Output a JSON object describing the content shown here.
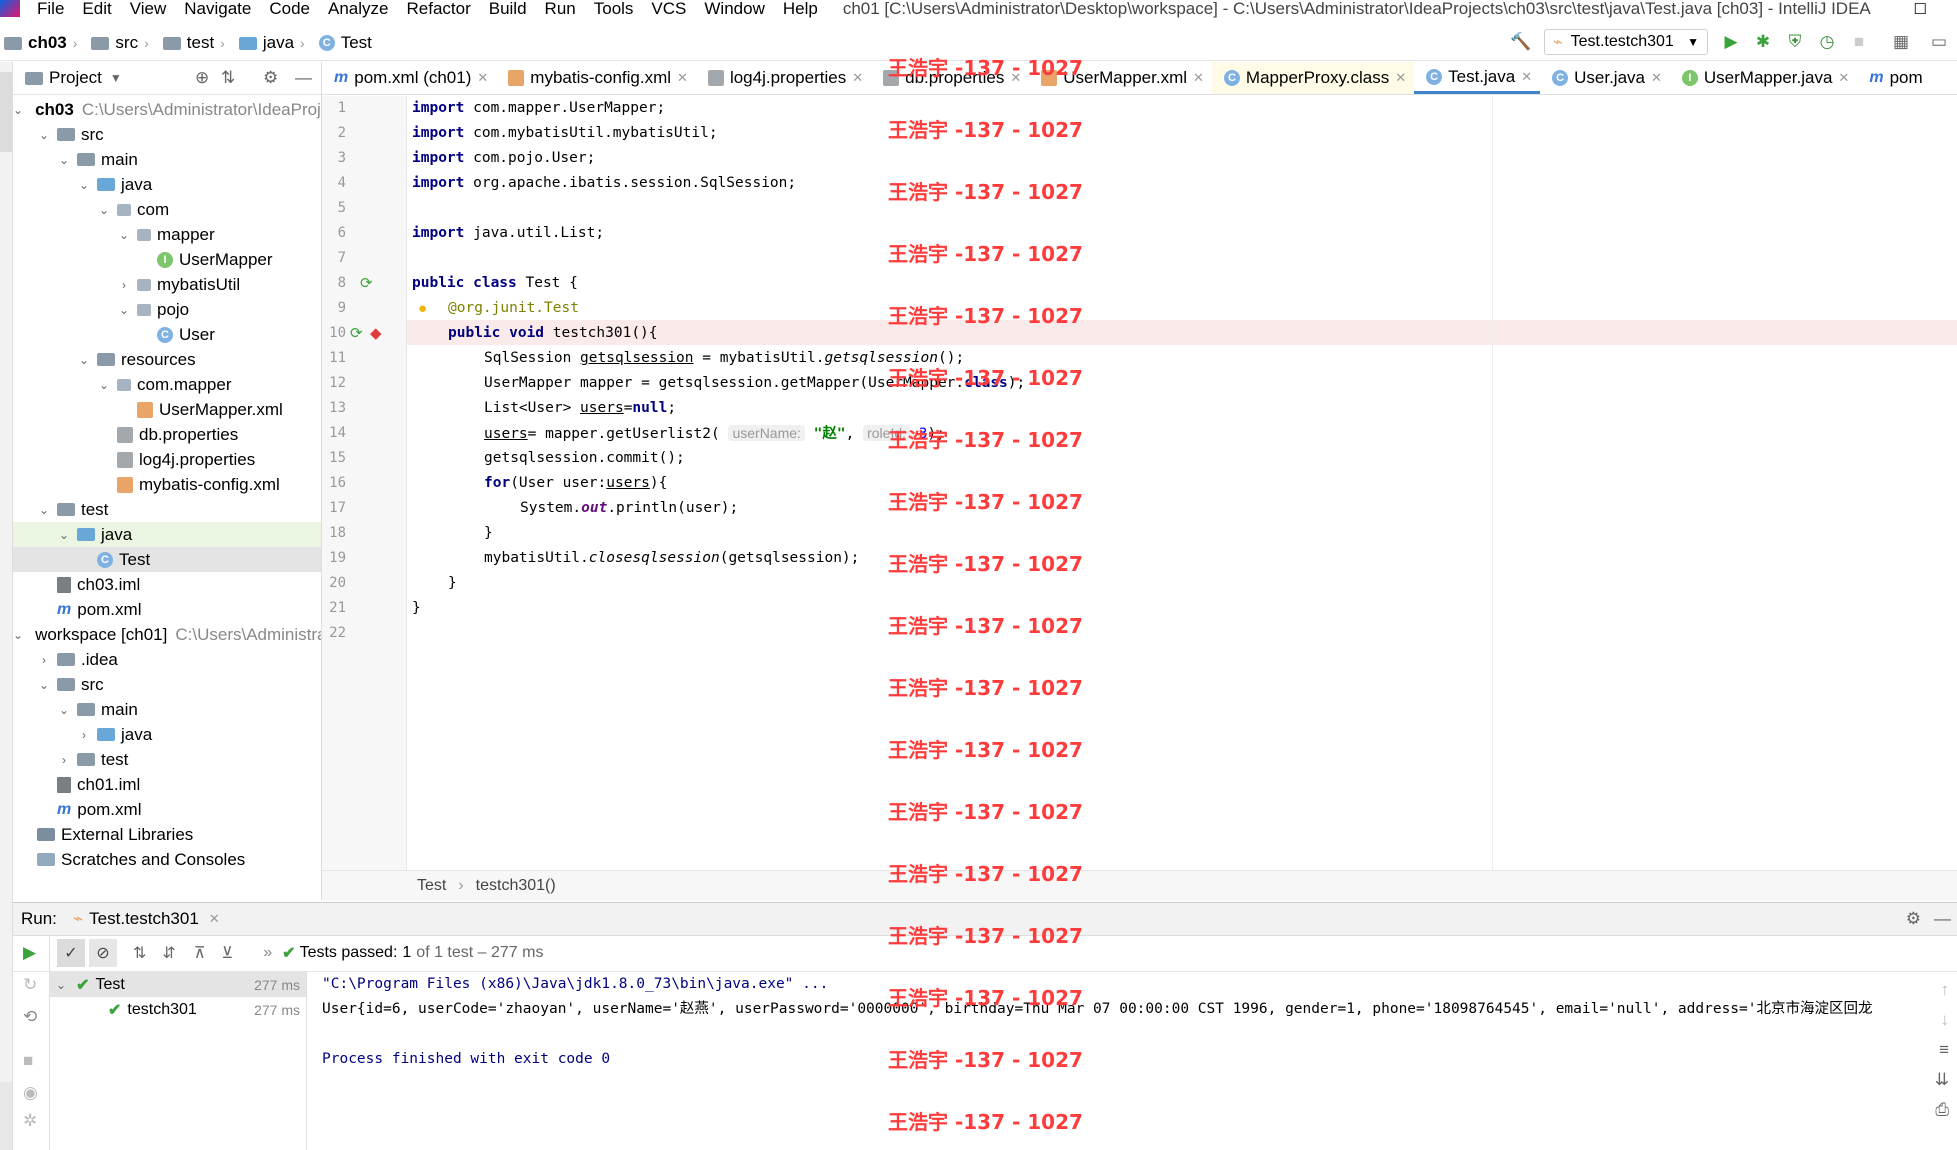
{
  "menu": {
    "items": [
      "File",
      "Edit",
      "View",
      "Navigate",
      "Code",
      "Analyze",
      "Refactor",
      "Build",
      "Run",
      "Tools",
      "VCS",
      "Window",
      "Help"
    ],
    "window_title": "ch01 [C:\\Users\\Administrator\\Desktop\\workspace] - C:\\Users\\Administrator\\IdeaProjects\\ch03\\src\\test\\java\\Test.java [ch03] - IntelliJ IDEA"
  },
  "nav": {
    "crumbs": [
      "ch03",
      "src",
      "test",
      "java",
      "Test"
    ],
    "run_config": "Test.testch301"
  },
  "project": {
    "header": "Project",
    "tree": [
      {
        "label": "ch03",
        "path": "C:\\Users\\Administrator\\IdeaProje",
        "icon": "module-folder-icon",
        "depth": 0,
        "open": true,
        "bold": true
      },
      {
        "label": "src",
        "icon": "folder-icon",
        "depth": 1,
        "open": true
      },
      {
        "label": "main",
        "icon": "folder-icon",
        "depth": 2,
        "open": true
      },
      {
        "label": "java",
        "icon": "source-folder-icon",
        "depth": 3,
        "open": true
      },
      {
        "label": "com",
        "icon": "package-icon",
        "depth": 4,
        "open": true
      },
      {
        "label": "mapper",
        "icon": "package-icon",
        "depth": 5,
        "open": true
      },
      {
        "label": "UserMapper",
        "icon": "interface-icon",
        "depth": 6
      },
      {
        "label": "mybatisUtil",
        "icon": "package-icon",
        "depth": 5,
        "open": false
      },
      {
        "label": "pojo",
        "icon": "package-icon",
        "depth": 5,
        "open": true
      },
      {
        "label": "User",
        "icon": "class-icon",
        "depth": 6
      },
      {
        "label": "resources",
        "icon": "folder-icon",
        "depth": 3,
        "open": true
      },
      {
        "label": "com.mapper",
        "icon": "package-icon",
        "depth": 4,
        "open": true
      },
      {
        "label": "UserMapper.xml",
        "icon": "xml-icon",
        "depth": 5
      },
      {
        "label": "db.properties",
        "icon": "properties-icon",
        "depth": 4
      },
      {
        "label": "log4j.properties",
        "icon": "properties-icon",
        "depth": 4
      },
      {
        "label": "mybatis-config.xml",
        "icon": "xml-icon",
        "depth": 4
      },
      {
        "label": "test",
        "icon": "folder-icon",
        "depth": 1,
        "open": true
      },
      {
        "label": "java",
        "icon": "source-folder-icon",
        "depth": 2,
        "open": true,
        "state": "selg"
      },
      {
        "label": "Test",
        "icon": "class-icon",
        "depth": 3,
        "state": "sel"
      },
      {
        "label": "ch03.iml",
        "icon": "iml-icon",
        "depth": 1
      },
      {
        "label": "pom.xml",
        "icon": "maven-icon",
        "depth": 1
      },
      {
        "label": "workspace [ch01]",
        "path": "C:\\Users\\Administra",
        "icon": "module-folder-icon",
        "depth": 0,
        "open": true
      },
      {
        "label": ".idea",
        "icon": "folder-icon",
        "depth": 1,
        "open": false
      },
      {
        "label": "src",
        "icon": "folder-icon",
        "depth": 1,
        "open": true
      },
      {
        "label": "main",
        "icon": "folder-icon",
        "depth": 2,
        "open": true
      },
      {
        "label": "java",
        "icon": "source-folder-icon",
        "depth": 3,
        "open": false
      },
      {
        "label": "test",
        "icon": "folder-icon",
        "depth": 2,
        "open": false
      },
      {
        "label": "ch01.iml",
        "icon": "iml-icon",
        "depth": 1
      },
      {
        "label": "pom.xml",
        "icon": "maven-icon",
        "depth": 1
      },
      {
        "label": "External Libraries",
        "icon": "libraries-icon",
        "depth": 0
      },
      {
        "label": "Scratches and Consoles",
        "icon": "scratches-icon",
        "depth": 0
      }
    ]
  },
  "tabs": [
    {
      "label": "pom.xml (ch01)",
      "icon": "maven-icon"
    },
    {
      "label": "mybatis-config.xml",
      "icon": "xml-icon"
    },
    {
      "label": "log4j.properties",
      "icon": "properties-icon"
    },
    {
      "label": "db.properties",
      "icon": "properties-icon"
    },
    {
      "label": "UserMapper.xml",
      "icon": "xml-icon"
    },
    {
      "label": "MapperProxy.class",
      "icon": "class-icon",
      "mod": true
    },
    {
      "label": "Test.java",
      "icon": "class-icon",
      "active": true
    },
    {
      "label": "User.java",
      "icon": "class-icon"
    },
    {
      "label": "UserMapper.java",
      "icon": "interface-icon"
    },
    {
      "label": "pom",
      "icon": "maven-icon"
    }
  ],
  "editor": {
    "line_numbers": [
      "1",
      "2",
      "3",
      "4",
      "5",
      "6",
      "7",
      "8",
      "9",
      "10",
      "11",
      "12",
      "13",
      "14",
      "15",
      "16",
      "17",
      "18",
      "19",
      "20",
      "21",
      "22"
    ],
    "lines": [
      "import com.mapper.UserMapper;",
      "import com.mybatisUtil.mybatisUtil;",
      "import com.pojo.User;",
      "import org.apache.ibatis.session.SqlSession;",
      "",
      "import java.util.List;",
      "",
      "public class Test {",
      "@org.junit.Test",
      "public void testch301(){",
      "SqlSession getsqlsession = mybatisUtil.getsqlsession();",
      "UserMapper mapper = getsqlsession.getMapper(UserMapper.class);",
      "List<User> users=null;",
      "users= mapper.getUserlist2(",
      "getsqlsession.commit();",
      "for(User user:users){",
      "System.out.println(user);",
      "}",
      "mybatisUtil.closesqlsession(getsqlsession);",
      "}",
      "}",
      ""
    ],
    "hint_username": "userName:",
    "hint_roleid": "roleId:",
    "arg_string": "\"赵\"",
    "arg_number": "3",
    "breadcrumb": [
      "Test",
      "testch301()"
    ]
  },
  "run": {
    "label": "Run:",
    "tab": "Test.testch301",
    "status_prefix": "Tests passed:",
    "status_count": "1",
    "status_suffix": "of 1 test – 277 ms",
    "tests": [
      {
        "name": "Test",
        "time": "277 ms"
      },
      {
        "name": "testch301",
        "time": "277 ms"
      }
    ],
    "console": [
      "\"C:\\Program Files (x86)\\Java\\jdk1.8.0_73\\bin\\java.exe\" ...",
      "User{id=6, userCode='zhaoyan', userName='赵燕', userPassword='0000000', birthday=Thu Mar 07 00:00:00 CST 1996, gender=1, phone='18098764545', email='null', address='北京市海淀区回龙",
      "",
      "Process finished with exit code 0"
    ]
  },
  "watermark": "王浩宇 -137 - 1027",
  "colors": {
    "accent": "#4083c9",
    "pass": "#3aa33a",
    "watermark": "#ff3b3b",
    "keyword": "#000080"
  }
}
